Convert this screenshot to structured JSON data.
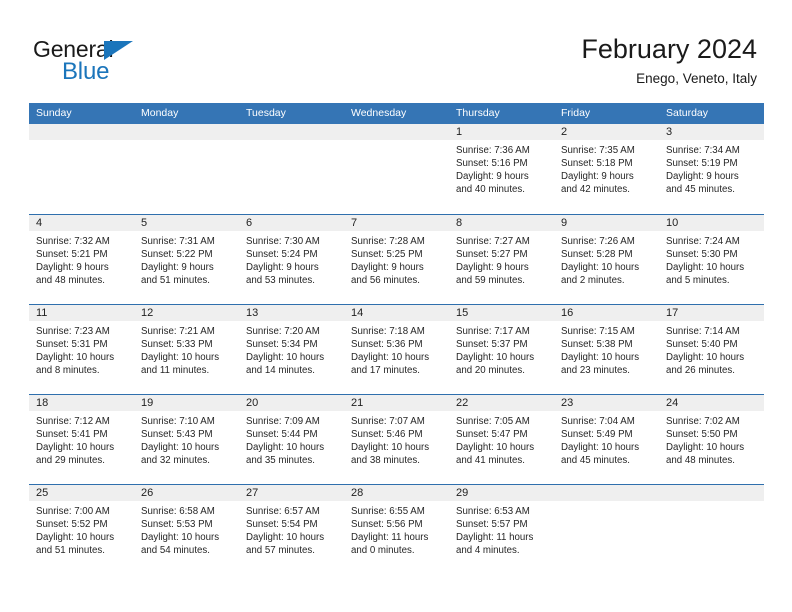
{
  "brand": {
    "name_top": "General",
    "name_bottom": "Blue",
    "accent_color": "#1b75bb"
  },
  "header": {
    "title": "February 2024",
    "subtitle": "Enego, Veneto, Italy"
  },
  "theme": {
    "header_row_color": "#3575b5",
    "row_divider_color": "#2f6fad",
    "day_band_color": "#efefef",
    "text_color": "#262626"
  },
  "weekdays": [
    "Sunday",
    "Monday",
    "Tuesday",
    "Wednesday",
    "Thursday",
    "Friday",
    "Saturday"
  ],
  "weeks": [
    [
      {
        "day": "",
        "empty": true
      },
      {
        "day": "",
        "empty": true
      },
      {
        "day": "",
        "empty": true
      },
      {
        "day": "",
        "empty": true
      },
      {
        "day": "1",
        "sunrise": "Sunrise: 7:36 AM",
        "sunset": "Sunset: 5:16 PM",
        "daylight1": "Daylight: 9 hours",
        "daylight2": "and 40 minutes."
      },
      {
        "day": "2",
        "sunrise": "Sunrise: 7:35 AM",
        "sunset": "Sunset: 5:18 PM",
        "daylight1": "Daylight: 9 hours",
        "daylight2": "and 42 minutes."
      },
      {
        "day": "3",
        "sunrise": "Sunrise: 7:34 AM",
        "sunset": "Sunset: 5:19 PM",
        "daylight1": "Daylight: 9 hours",
        "daylight2": "and 45 minutes."
      }
    ],
    [
      {
        "day": "4",
        "sunrise": "Sunrise: 7:32 AM",
        "sunset": "Sunset: 5:21 PM",
        "daylight1": "Daylight: 9 hours",
        "daylight2": "and 48 minutes."
      },
      {
        "day": "5",
        "sunrise": "Sunrise: 7:31 AM",
        "sunset": "Sunset: 5:22 PM",
        "daylight1": "Daylight: 9 hours",
        "daylight2": "and 51 minutes."
      },
      {
        "day": "6",
        "sunrise": "Sunrise: 7:30 AM",
        "sunset": "Sunset: 5:24 PM",
        "daylight1": "Daylight: 9 hours",
        "daylight2": "and 53 minutes."
      },
      {
        "day": "7",
        "sunrise": "Sunrise: 7:28 AM",
        "sunset": "Sunset: 5:25 PM",
        "daylight1": "Daylight: 9 hours",
        "daylight2": "and 56 minutes."
      },
      {
        "day": "8",
        "sunrise": "Sunrise: 7:27 AM",
        "sunset": "Sunset: 5:27 PM",
        "daylight1": "Daylight: 9 hours",
        "daylight2": "and 59 minutes."
      },
      {
        "day": "9",
        "sunrise": "Sunrise: 7:26 AM",
        "sunset": "Sunset: 5:28 PM",
        "daylight1": "Daylight: 10 hours",
        "daylight2": "and 2 minutes."
      },
      {
        "day": "10",
        "sunrise": "Sunrise: 7:24 AM",
        "sunset": "Sunset: 5:30 PM",
        "daylight1": "Daylight: 10 hours",
        "daylight2": "and 5 minutes."
      }
    ],
    [
      {
        "day": "11",
        "sunrise": "Sunrise: 7:23 AM",
        "sunset": "Sunset: 5:31 PM",
        "daylight1": "Daylight: 10 hours",
        "daylight2": "and 8 minutes."
      },
      {
        "day": "12",
        "sunrise": "Sunrise: 7:21 AM",
        "sunset": "Sunset: 5:33 PM",
        "daylight1": "Daylight: 10 hours",
        "daylight2": "and 11 minutes."
      },
      {
        "day": "13",
        "sunrise": "Sunrise: 7:20 AM",
        "sunset": "Sunset: 5:34 PM",
        "daylight1": "Daylight: 10 hours",
        "daylight2": "and 14 minutes."
      },
      {
        "day": "14",
        "sunrise": "Sunrise: 7:18 AM",
        "sunset": "Sunset: 5:36 PM",
        "daylight1": "Daylight: 10 hours",
        "daylight2": "and 17 minutes."
      },
      {
        "day": "15",
        "sunrise": "Sunrise: 7:17 AM",
        "sunset": "Sunset: 5:37 PM",
        "daylight1": "Daylight: 10 hours",
        "daylight2": "and 20 minutes."
      },
      {
        "day": "16",
        "sunrise": "Sunrise: 7:15 AM",
        "sunset": "Sunset: 5:38 PM",
        "daylight1": "Daylight: 10 hours",
        "daylight2": "and 23 minutes."
      },
      {
        "day": "17",
        "sunrise": "Sunrise: 7:14 AM",
        "sunset": "Sunset: 5:40 PM",
        "daylight1": "Daylight: 10 hours",
        "daylight2": "and 26 minutes."
      }
    ],
    [
      {
        "day": "18",
        "sunrise": "Sunrise: 7:12 AM",
        "sunset": "Sunset: 5:41 PM",
        "daylight1": "Daylight: 10 hours",
        "daylight2": "and 29 minutes."
      },
      {
        "day": "19",
        "sunrise": "Sunrise: 7:10 AM",
        "sunset": "Sunset: 5:43 PM",
        "daylight1": "Daylight: 10 hours",
        "daylight2": "and 32 minutes."
      },
      {
        "day": "20",
        "sunrise": "Sunrise: 7:09 AM",
        "sunset": "Sunset: 5:44 PM",
        "daylight1": "Daylight: 10 hours",
        "daylight2": "and 35 minutes."
      },
      {
        "day": "21",
        "sunrise": "Sunrise: 7:07 AM",
        "sunset": "Sunset: 5:46 PM",
        "daylight1": "Daylight: 10 hours",
        "daylight2": "and 38 minutes."
      },
      {
        "day": "22",
        "sunrise": "Sunrise: 7:05 AM",
        "sunset": "Sunset: 5:47 PM",
        "daylight1": "Daylight: 10 hours",
        "daylight2": "and 41 minutes."
      },
      {
        "day": "23",
        "sunrise": "Sunrise: 7:04 AM",
        "sunset": "Sunset: 5:49 PM",
        "daylight1": "Daylight: 10 hours",
        "daylight2": "and 45 minutes."
      },
      {
        "day": "24",
        "sunrise": "Sunrise: 7:02 AM",
        "sunset": "Sunset: 5:50 PM",
        "daylight1": "Daylight: 10 hours",
        "daylight2": "and 48 minutes."
      }
    ],
    [
      {
        "day": "25",
        "sunrise": "Sunrise: 7:00 AM",
        "sunset": "Sunset: 5:52 PM",
        "daylight1": "Daylight: 10 hours",
        "daylight2": "and 51 minutes."
      },
      {
        "day": "26",
        "sunrise": "Sunrise: 6:58 AM",
        "sunset": "Sunset: 5:53 PM",
        "daylight1": "Daylight: 10 hours",
        "daylight2": "and 54 minutes."
      },
      {
        "day": "27",
        "sunrise": "Sunrise: 6:57 AM",
        "sunset": "Sunset: 5:54 PM",
        "daylight1": "Daylight: 10 hours",
        "daylight2": "and 57 minutes."
      },
      {
        "day": "28",
        "sunrise": "Sunrise: 6:55 AM",
        "sunset": "Sunset: 5:56 PM",
        "daylight1": "Daylight: 11 hours",
        "daylight2": "and 0 minutes."
      },
      {
        "day": "29",
        "sunrise": "Sunrise: 6:53 AM",
        "sunset": "Sunset: 5:57 PM",
        "daylight1": "Daylight: 11 hours",
        "daylight2": "and 4 minutes."
      },
      {
        "day": "",
        "empty": true
      },
      {
        "day": "",
        "empty": true
      }
    ]
  ]
}
